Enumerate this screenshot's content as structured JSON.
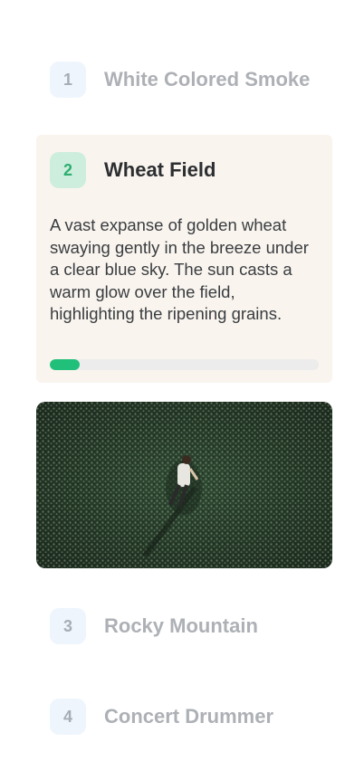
{
  "items": [
    {
      "number": "1",
      "title": "White Colored Smoke"
    },
    {
      "number": "2",
      "title": "Wheat Field",
      "description": "A vast expanse of golden wheat swaying gently in the breeze under a clear blue sky. The sun casts a warm glow over the field, highlighting the ripening grains.",
      "progress": 0.11
    },
    {
      "number": "3",
      "title": "Rocky Mountain"
    },
    {
      "number": "4",
      "title": "Concert Drummer"
    }
  ],
  "colors": {
    "accent": "#21c07a",
    "active_card_bg": "#f9f4ee",
    "inactive_number_bg": "#eef5fd",
    "active_number_bg": "#cdeedd"
  }
}
